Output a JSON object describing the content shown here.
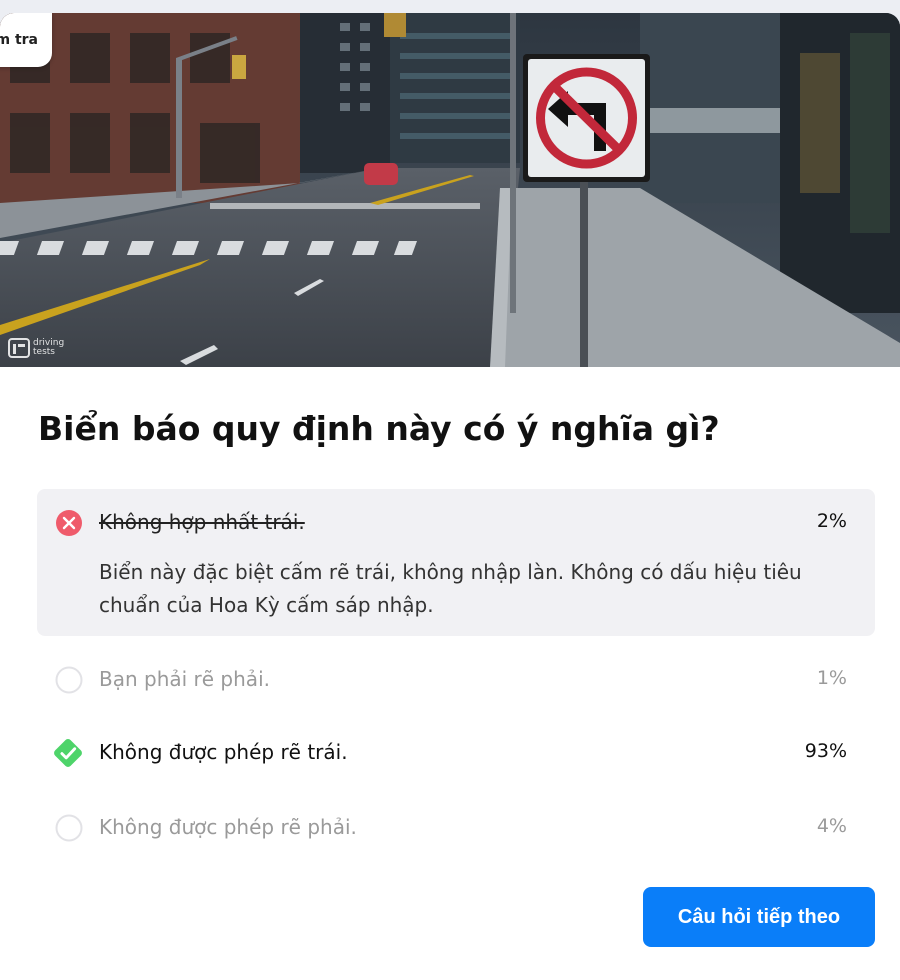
{
  "tab": {
    "label": "m tra"
  },
  "logo": {
    "text": "driving\ntests"
  },
  "question": "Biển báo quy định này có ý nghĩa gì?",
  "answers": [
    {
      "text": "Không hợp nhất trái.",
      "percent": "2%",
      "status": "incorrect",
      "explanation": "Biển này đặc biệt cấm rẽ trái, không nhập làn. Không có dấu hiệu tiêu chuẩn của Hoa Kỳ cấm sáp nhập.",
      "icon": "x-circle-icon"
    },
    {
      "text": "Bạn phải rẽ phải.",
      "percent": "1%",
      "status": "unselected",
      "icon": "empty-circle-icon"
    },
    {
      "text": "Không được phép rẽ trái.",
      "percent": "93%",
      "status": "correct",
      "icon": "check-diamond-icon"
    },
    {
      "text": "Không được phép rẽ phải.",
      "percent": "4%",
      "status": "unselected",
      "icon": "empty-circle-icon"
    }
  ],
  "next_button": "Câu hỏi tiếp theo",
  "colors": {
    "accent": "#0a7ef9",
    "correct": "#4ed46a",
    "incorrect": "#ef5b6b",
    "wrong_bg": "#f1f1f4"
  }
}
